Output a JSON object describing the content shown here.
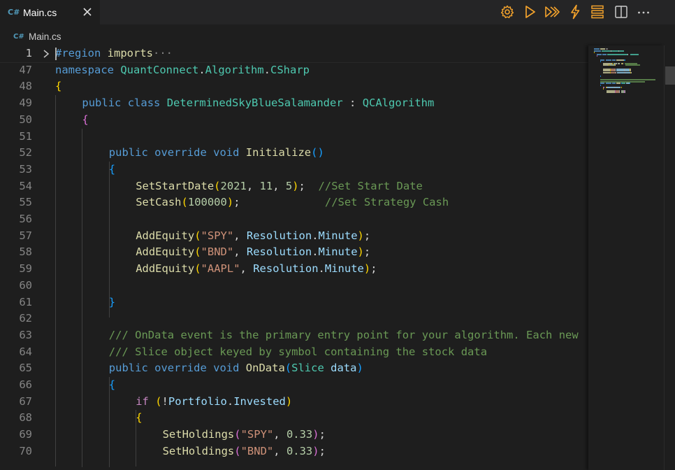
{
  "tab": {
    "icon": "C#",
    "label": "Main.cs"
  },
  "breadcrumb": {
    "icon": "C#",
    "label": "Main.cs"
  },
  "toolbar": [
    {
      "name": "settings-gear-icon"
    },
    {
      "name": "run-icon"
    },
    {
      "name": "run-all-icon"
    },
    {
      "name": "lightning-icon"
    },
    {
      "name": "stack-icon"
    },
    {
      "name": "split-editor-icon"
    },
    {
      "name": "more-actions-icon"
    }
  ],
  "colors": {
    "accent": "#f2a22c",
    "background": "#1e1e1e"
  },
  "lines": [
    {
      "n": "1",
      "indent": 0,
      "tokens": [
        [
          "kw",
          "#region "
        ],
        [
          "fn",
          "imports"
        ],
        [
          "ell",
          "···"
        ]
      ]
    },
    {
      "n": "47",
      "indent": 0,
      "tokens": [
        [
          "kw",
          "namespace "
        ],
        [
          "ns",
          "QuantConnect"
        ],
        [
          "p",
          "."
        ],
        [
          "ns",
          "Algorithm"
        ],
        [
          "p",
          "."
        ],
        [
          "ns",
          "CSharp"
        ]
      ]
    },
    {
      "n": "48",
      "indent": 0,
      "tokens": [
        [
          "b1",
          "{"
        ]
      ]
    },
    {
      "n": "49",
      "indent": 1,
      "tokens": [
        [
          "kw",
          "public "
        ],
        [
          "kw",
          "class "
        ],
        [
          "ns",
          "DeterminedSkyBlueSalamander"
        ],
        [
          "p",
          " : "
        ],
        [
          "ns",
          "QCAlgorithm"
        ]
      ]
    },
    {
      "n": "50",
      "indent": 1,
      "tokens": [
        [
          "b2",
          "{"
        ]
      ]
    },
    {
      "n": "51",
      "indent": 0,
      "tokens": []
    },
    {
      "n": "52",
      "indent": 2,
      "tokens": [
        [
          "kw",
          "public "
        ],
        [
          "kw",
          "override "
        ],
        [
          "kw",
          "void "
        ],
        [
          "fn",
          "Initialize"
        ],
        [
          "b3",
          "()"
        ]
      ]
    },
    {
      "n": "53",
      "indent": 2,
      "tokens": [
        [
          "b3",
          "{"
        ]
      ]
    },
    {
      "n": "54",
      "indent": 3,
      "tokens": [
        [
          "fn",
          "SetStartDate"
        ],
        [
          "b1",
          "("
        ],
        [
          "num",
          "2021"
        ],
        [
          "p",
          ", "
        ],
        [
          "num",
          "11"
        ],
        [
          "p",
          ", "
        ],
        [
          "num",
          "5"
        ],
        [
          "b1",
          ")"
        ],
        [
          "p",
          ";  "
        ],
        [
          "cmt",
          "//Set Start Date"
        ]
      ]
    },
    {
      "n": "55",
      "indent": 3,
      "tokens": [
        [
          "fn",
          "SetCash"
        ],
        [
          "b1",
          "("
        ],
        [
          "num",
          "100000"
        ],
        [
          "b1",
          ")"
        ],
        [
          "p",
          ";             "
        ],
        [
          "cmt",
          "//Set Strategy Cash"
        ]
      ]
    },
    {
      "n": "56",
      "indent": 0,
      "tokens": []
    },
    {
      "n": "57",
      "indent": 3,
      "tokens": [
        [
          "fn",
          "AddEquity"
        ],
        [
          "b1",
          "("
        ],
        [
          "str",
          "\"SPY\""
        ],
        [
          "p",
          ", "
        ],
        [
          "var",
          "Resolution"
        ],
        [
          "p",
          "."
        ],
        [
          "var",
          "Minute"
        ],
        [
          "b1",
          ")"
        ],
        [
          "p",
          ";"
        ]
      ]
    },
    {
      "n": "58",
      "indent": 3,
      "tokens": [
        [
          "fn",
          "AddEquity"
        ],
        [
          "b1",
          "("
        ],
        [
          "str",
          "\"BND\""
        ],
        [
          "p",
          ", "
        ],
        [
          "var",
          "Resolution"
        ],
        [
          "p",
          "."
        ],
        [
          "var",
          "Minute"
        ],
        [
          "b1",
          ")"
        ],
        [
          "p",
          ";"
        ]
      ]
    },
    {
      "n": "59",
      "indent": 3,
      "tokens": [
        [
          "fn",
          "AddEquity"
        ],
        [
          "b1",
          "("
        ],
        [
          "str",
          "\"AAPL\""
        ],
        [
          "p",
          ", "
        ],
        [
          "var",
          "Resolution"
        ],
        [
          "p",
          "."
        ],
        [
          "var",
          "Minute"
        ],
        [
          "b1",
          ")"
        ],
        [
          "p",
          ";"
        ]
      ]
    },
    {
      "n": "60",
      "indent": 0,
      "tokens": []
    },
    {
      "n": "61",
      "indent": 2,
      "tokens": [
        [
          "b3",
          "}"
        ]
      ]
    },
    {
      "n": "62",
      "indent": 0,
      "tokens": []
    },
    {
      "n": "63",
      "indent": 2,
      "tokens": [
        [
          "cmt",
          "/// OnData event is the primary entry point for your algorithm. Each new"
        ]
      ]
    },
    {
      "n": "64",
      "indent": 2,
      "tokens": [
        [
          "cmt",
          "/// Slice object keyed by symbol containing the stock data"
        ]
      ]
    },
    {
      "n": "65",
      "indent": 2,
      "tokens": [
        [
          "kw",
          "public "
        ],
        [
          "kw",
          "override "
        ],
        [
          "kw",
          "void "
        ],
        [
          "fn",
          "OnData"
        ],
        [
          "b3",
          "("
        ],
        [
          "ns",
          "Slice "
        ],
        [
          "var",
          "data"
        ],
        [
          "b3",
          ")"
        ]
      ]
    },
    {
      "n": "66",
      "indent": 2,
      "tokens": [
        [
          "b3",
          "{"
        ]
      ]
    },
    {
      "n": "67",
      "indent": 3,
      "tokens": [
        [
          "ctl",
          "if "
        ],
        [
          "b1",
          "("
        ],
        [
          "p",
          "!"
        ],
        [
          "var",
          "Portfolio"
        ],
        [
          "p",
          "."
        ],
        [
          "var",
          "Invested"
        ],
        [
          "b1",
          ")"
        ]
      ]
    },
    {
      "n": "68",
      "indent": 3,
      "tokens": [
        [
          "b1",
          "{"
        ]
      ]
    },
    {
      "n": "69",
      "indent": 4,
      "tokens": [
        [
          "fn",
          "SetHoldings"
        ],
        [
          "b2",
          "("
        ],
        [
          "str",
          "\"SPY\""
        ],
        [
          "p",
          ", "
        ],
        [
          "num",
          "0.33"
        ],
        [
          "b2",
          ")"
        ],
        [
          "p",
          ";"
        ]
      ]
    },
    {
      "n": "70",
      "indent": 4,
      "tokens": [
        [
          "fn",
          "SetHoldings"
        ],
        [
          "b2",
          "("
        ],
        [
          "str",
          "\"BND\""
        ],
        [
          "p",
          ", "
        ],
        [
          "num",
          "0.33"
        ],
        [
          "b2",
          ")"
        ],
        [
          "p",
          ";"
        ]
      ]
    }
  ]
}
